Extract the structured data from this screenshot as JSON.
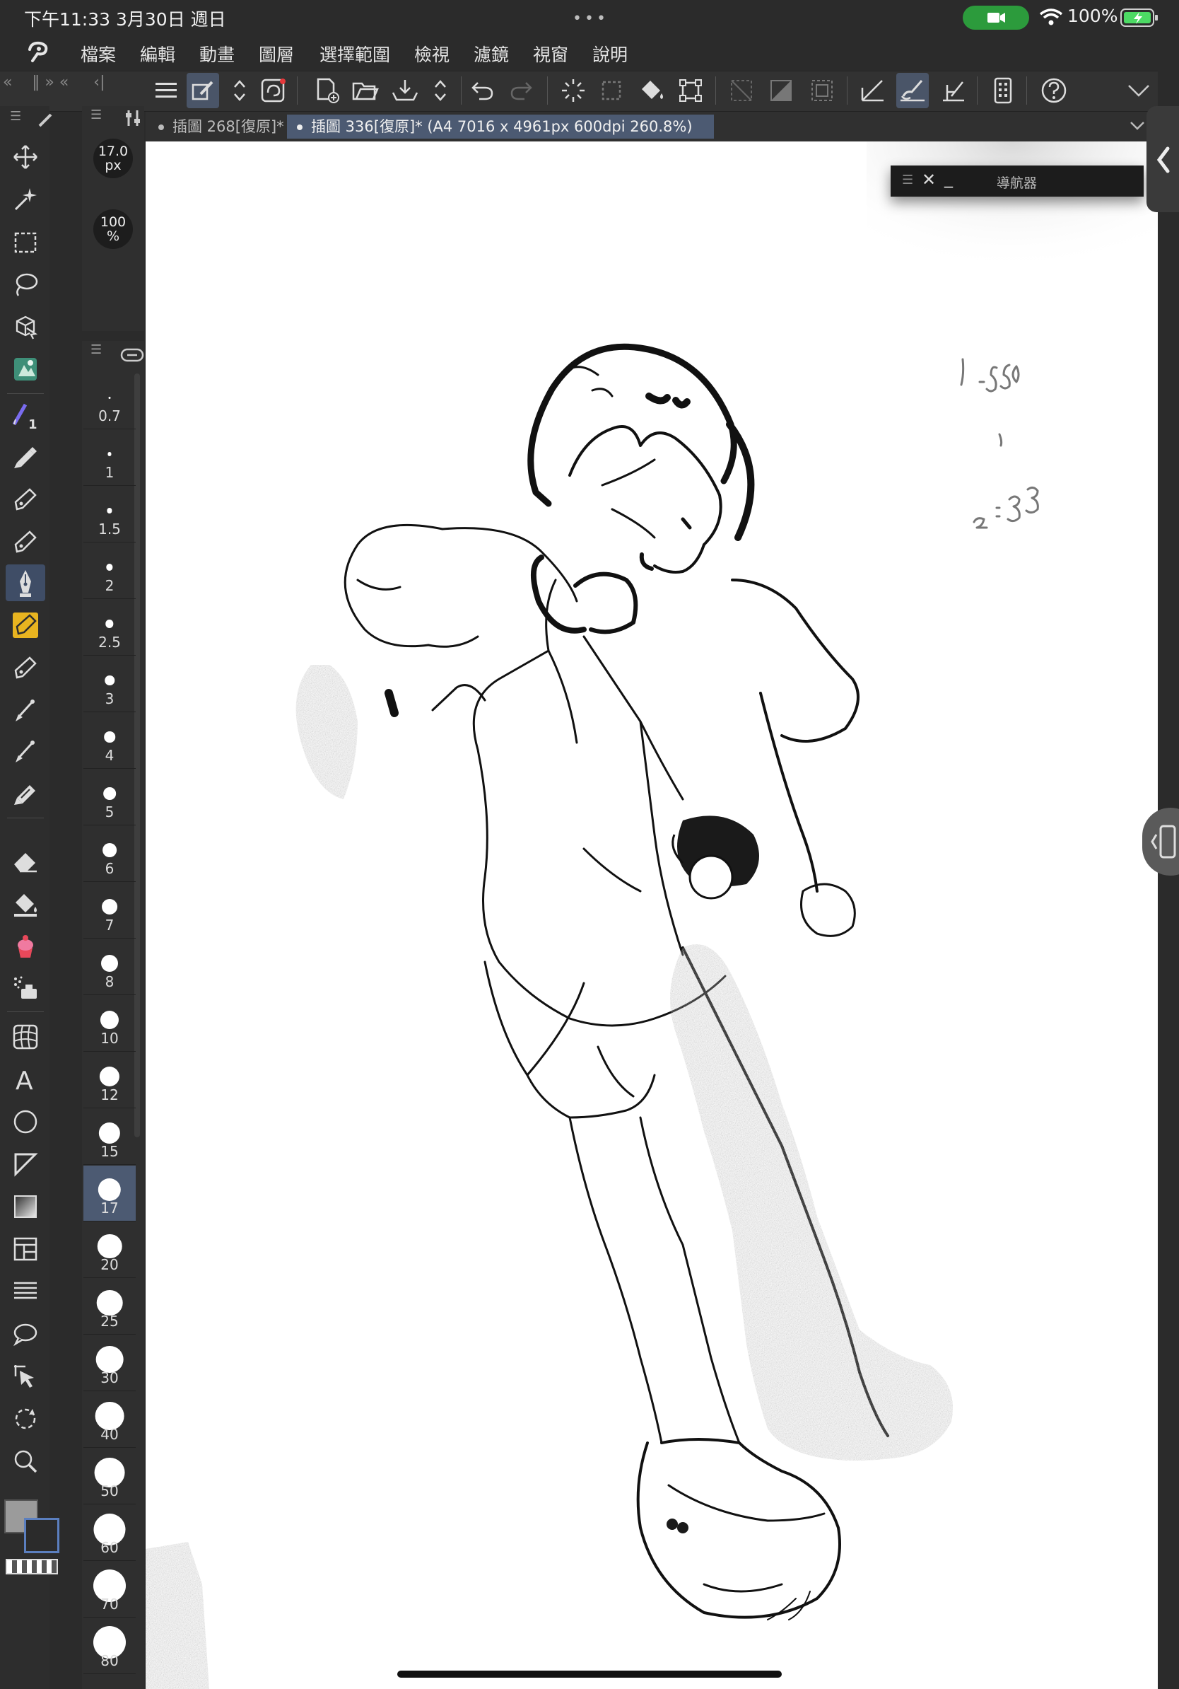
{
  "status_bar": {
    "time": "下午11:33",
    "date": "3月30日 週日",
    "battery": "100%"
  },
  "menu": {
    "items": [
      "檔案",
      "編輯",
      "動畫",
      "圖層",
      "選擇範圍",
      "檢視",
      "濾鏡",
      "視窗",
      "說明"
    ]
  },
  "tabs": [
    {
      "label": "插圖 268[復原]*",
      "active": false
    },
    {
      "label": "插圖 336[復原]* (A4 7016 x 4961px 600dpi 260.8%)",
      "active": true
    }
  ],
  "tool_property": {
    "brush_size": "17.0",
    "brush_unit": "px",
    "opacity": "100",
    "opacity_unit": "%"
  },
  "brush_sizes": [
    {
      "label": "0.7"
    },
    {
      "label": "1"
    },
    {
      "label": "1.5"
    },
    {
      "label": "2"
    },
    {
      "label": "2.5"
    },
    {
      "label": "3"
    },
    {
      "label": "4"
    },
    {
      "label": "5"
    },
    {
      "label": "6"
    },
    {
      "label": "7"
    },
    {
      "label": "8"
    },
    {
      "label": "10"
    },
    {
      "label": "12"
    },
    {
      "label": "15"
    },
    {
      "label": "17",
      "selected": true
    },
    {
      "label": "20"
    },
    {
      "label": "25"
    },
    {
      "label": "30"
    },
    {
      "label": "40"
    },
    {
      "label": "50"
    },
    {
      "label": "60"
    },
    {
      "label": "70"
    },
    {
      "label": "80"
    }
  ],
  "navigator": {
    "title": "導航器"
  },
  "tools": [
    "move-icon",
    "auto-select-icon",
    "rect-select-icon",
    "lasso-icon",
    "3d-select-icon",
    "reference-image-icon",
    "color-pencil-icon",
    "pen-icon",
    "pen-icon",
    "pen-icon",
    "g-pen-icon",
    "marker-icon",
    "pencil-icon",
    "brush-icon",
    "airbrush-icon",
    "decoration-icon",
    "eraser-icon",
    "fill-icon",
    "blend-icon",
    "airbrush-tone-icon",
    "frame-icon",
    "text-icon",
    "ellipse-icon",
    "ruler-icon",
    "gradient-icon",
    "panel-icon",
    "lines-icon",
    "speech-bubble-icon",
    "object-select-icon",
    "rotate-icon",
    "zoom-icon"
  ],
  "colors": {
    "accent": "#4c5a72",
    "camera_green": "#2c9b3c",
    "main_color": "#9b9b9b",
    "sub_color": "#2b2b2b"
  }
}
